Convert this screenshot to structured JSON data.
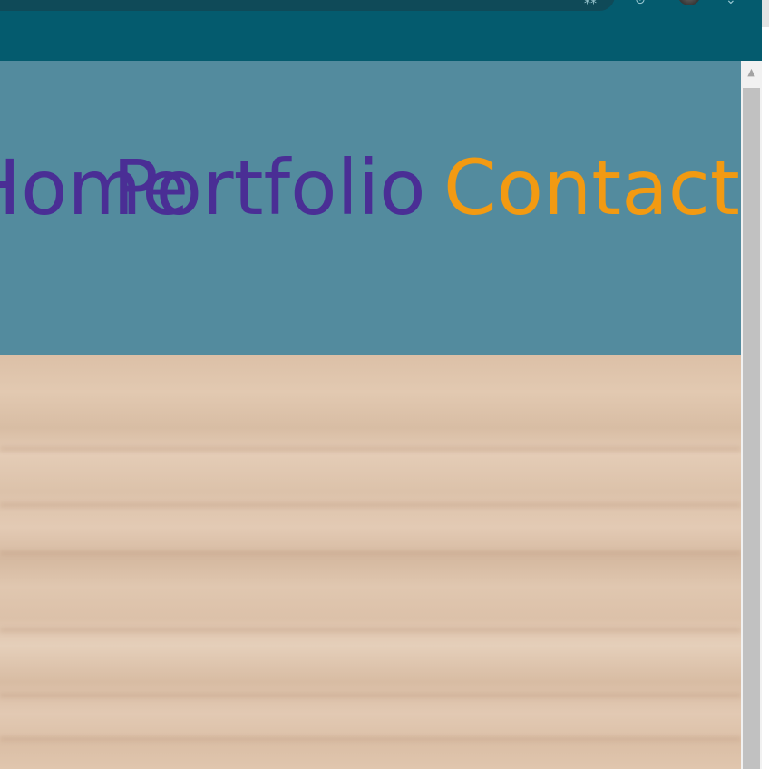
{
  "browser": {
    "toolbar_icons": [
      "extensions-icon",
      "tab-search-icon",
      "profile-avatar",
      "chevron-down-icon"
    ]
  },
  "nav": {
    "home_label": "Home",
    "portfolio_label": "Portfolio",
    "contact_label": "Contact"
  },
  "colors": {
    "browser_toolbar": "#045b6e",
    "header_background": "#538b9e",
    "nav_link": "#4a2e95",
    "nav_link_active": "#f29a12",
    "wood_light": "#e4ccb6",
    "wood_dark": "#d5b9a0",
    "scrollbar_thumb": "#c1c1c1"
  },
  "hero": {
    "background_icon": "wood-texture-background"
  }
}
